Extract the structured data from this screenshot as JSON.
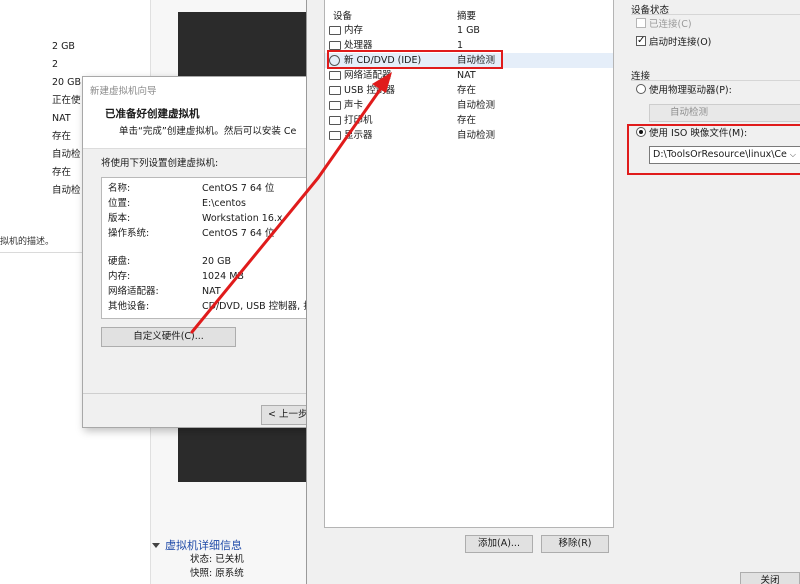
{
  "background": {
    "specs": [
      "2 GB",
      "2",
      "20 GB",
      "正在使",
      "NAT",
      "存在",
      "自动检",
      "存在",
      "自动检"
    ],
    "description": "拟机的描述。",
    "details": {
      "title": "虚拟机详细信息",
      "status_label": "状态: 已关机",
      "snapshot_label": "快照: 原系统"
    }
  },
  "wizard": {
    "title": "新建虚拟机向导",
    "heading": "已准备好创建虚拟机",
    "subheading": "单击“完成”创建虚拟机。然后可以安装 Ce",
    "lead": "将使用下列设置创建虚拟机:",
    "summary": [
      {
        "key": "名称:",
        "value": "CentOS 7 64 位"
      },
      {
        "key": "位置:",
        "value": "E:\\centos"
      },
      {
        "key": "版本:",
        "value": "Workstation 16.x"
      },
      {
        "key": "操作系统:",
        "value": "CentOS 7 64 位"
      },
      {
        "key": "硬盘:",
        "value": "20 GB"
      },
      {
        "key": "内存:",
        "value": "1024 MB"
      },
      {
        "key": "网络适配器:",
        "value": "NAT"
      },
      {
        "key": "其他设备:",
        "value": "CD/DVD, USB 控制器, 打"
      }
    ],
    "customize_button": "自定义硬件(C)...",
    "back_button": "< 上一步"
  },
  "hardware": {
    "col_device": "设备",
    "col_summary": "摘要",
    "devices": [
      {
        "name": "内存",
        "summary": "1 GB"
      },
      {
        "name": "处理器",
        "summary": "1"
      },
      {
        "name": "新 CD/DVD (IDE)",
        "summary": "自动检测"
      },
      {
        "name": "网络适配器",
        "summary": "NAT"
      },
      {
        "name": "USB 控制器",
        "summary": "存在"
      },
      {
        "name": "声卡",
        "summary": "自动检测"
      },
      {
        "name": "打印机",
        "summary": "存在"
      },
      {
        "name": "显示器",
        "summary": "自动检测"
      }
    ],
    "add_button": "添加(A)...",
    "remove_button": "移除(R)",
    "close_button": "关闭"
  },
  "device_status": {
    "title": "设备状态",
    "connected": "已连接(C)",
    "connect_on_power": "启动时连接(O)"
  },
  "connection": {
    "title": "连接",
    "physical_drive": "使用物理驱动器(P):",
    "physical_value": "自动检测",
    "iso_image": "使用 ISO 映像文件(M):",
    "iso_value": "D:\\ToolsOrResource\\linux\\Ce"
  },
  "colors": {
    "highlight": "#e01b1b",
    "vm_screen": "#2b2b2b",
    "selection": "#e5eef9"
  }
}
